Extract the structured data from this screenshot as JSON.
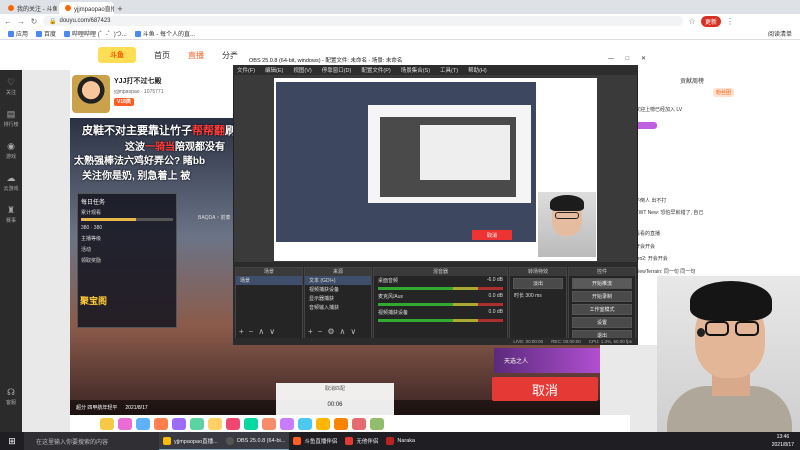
{
  "browser": {
    "tabs": [
      {
        "label": "我的关注 - 斗鱼",
        "active": false
      },
      {
        "label": "yjjmpaopao直播_永劫无间",
        "active": true
      },
      {
        "label": "",
        "active": false
      }
    ],
    "url": "douyu.com/687423",
    "update_label": "更新",
    "bookmarks": [
      "应用",
      "百度",
      "哔哩哔哩 (゜-゜)つ...",
      "斗鱼 - 每个人的直..."
    ],
    "read_list": "阅读清单"
  },
  "douyu_nav": {
    "logo": "斗鱼",
    "links": [
      "首页",
      "直播",
      "分类"
    ],
    "active": "直播"
  },
  "left_sidebar": [
    "关注",
    "排行榜",
    "游戏",
    "云游戏",
    "赛事",
    "客服"
  ],
  "room": {
    "title": "YJJ打不过七殿",
    "streamer": "yjjmpaopao",
    "followers": "1075771",
    "level_tag": "V18类"
  },
  "danmu": [
    {
      "pre": "皮鞋不对主要靠让竹子",
      "hl": "帮帮翻",
      "post": "刷"
    },
    {
      "pre": "这波",
      "hl": "一骑当",
      "post": "陪观都没有"
    },
    {
      "pre": "太熟强棒法",
      "hl": "",
      "post": "六鸡好弄公? 睹bb"
    },
    {
      "pre": "关注",
      "hl": "",
      "post": "你是奶, 别急着上 被"
    }
  ],
  "task_panel": {
    "title": "每日任务",
    "rows": [
      "累计观看",
      "主播等级",
      "活动",
      "领取奖励"
    ],
    "count_a": "380",
    "count_b": "380",
    "treasure_label": "聚宝阁"
  },
  "baqi_label": "BAQDA・前奏",
  "stream_bottom": "超分 四甲航年轻平",
  "stream_date": "2021/8/17",
  "obs": {
    "title": "OBS 25.0.8 (64-bit, windows) - 配置文件: 未命名 - 场景: 未命名",
    "window_controls": "— □ ✕",
    "menu": [
      "文件(F)",
      "编辑(E)",
      "视图(V)",
      "停靠窗口(D)",
      "配置文件(P)",
      "场景集合(S)",
      "工具(T)",
      "帮助(H)"
    ],
    "dock_scenes": {
      "title": "场景",
      "items": [
        "场景"
      ]
    },
    "dock_sources": {
      "title": "来源",
      "items": [
        "文本 (GDI+)",
        "视频捕获设备",
        "显示器捕获",
        "音频输入捕获"
      ]
    },
    "dock_mixer": {
      "title": "混音器",
      "channels": [
        "桌面音频",
        "麦克风/Aux",
        "视频捕获设备"
      ],
      "db": [
        "-6.0 dB",
        "0.0 dB",
        "0.0 dB"
      ]
    },
    "dock_transitions": {
      "title": "转场特效",
      "type": "淡出",
      "duration_label": "时长",
      "duration": "300 ms"
    },
    "dock_controls": {
      "title": "控件",
      "buttons": [
        "开始推流",
        "开始录制",
        "工作室模式",
        "设置",
        "退出"
      ]
    },
    "status": [
      "LIVE: 00:00:00",
      "REC: 00:00:00",
      "CPU: 1.3%, 60.00 fps"
    ],
    "preview_cancel_label": "取消"
  },
  "overlay": {
    "cancel_title": "取消匹配",
    "cancel_time": "00:06",
    "big_cancel": "取消",
    "tianxuan": "天选之人"
  },
  "chat": {
    "rank_label": "贡献周榜",
    "rank_btn": "粉丝团",
    "lines": [
      "欢迎上榜已经加入 LV",
      "不倒人 出不打",
      "CWT New: 恐怕早就错了, 自己",
      "看看的直播",
      "开会开会",
      "pro2: 开会开会",
      "ViewTerrain: 同一句 同一句",
      "同一句"
    ]
  },
  "taskbar": {
    "search_placeholder": "在这里输入你要搜索的内容",
    "apps": [
      "yjjmpaopao直播...",
      "OBS 25.0.8 (64-bi...",
      "斗鱼直播伴侣",
      "无他伴侣",
      "Naraka"
    ],
    "time": "13:46",
    "date": "2021/8/17"
  },
  "colors": {
    "accent": "#ff5d23",
    "obs_bg": "#2b2b2b",
    "cancel_red": "#e53935"
  }
}
